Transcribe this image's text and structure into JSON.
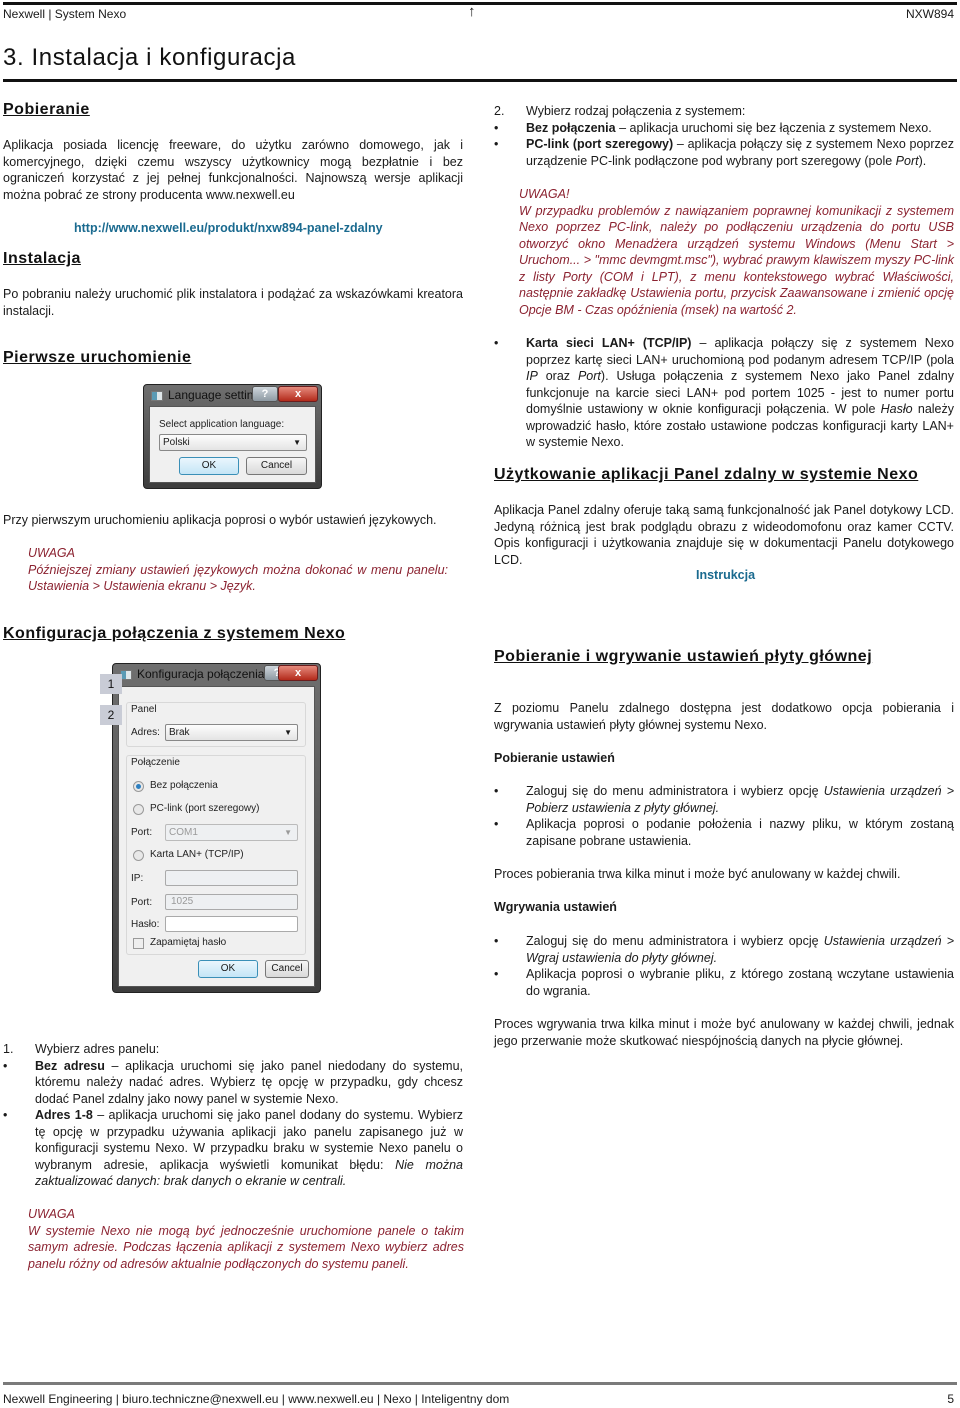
{
  "header": {
    "left": "Nexwell | System Nexo",
    "up_icon": "↑",
    "right": "NXW894"
  },
  "title": "3. Instalacja i konfiguracja",
  "left": {
    "pobieranie": {
      "heading": "Pobieranie",
      "text": "Aplikacja posiada licencję freeware, do użytku zarówno domowego, jak i komercyjnego, dzięki czemu wszyscy użytkownicy mogą bezpłatnie i bez ograniczeń korzystać z jej pełnej funkcjonalności. Najnowszą wersje aplikacji można pobrać ze strony producenta www.nexwell.eu",
      "link": "http://www.nexwell.eu/produkt/nxw894-panel-zdalny"
    },
    "instalacja": {
      "heading": "Instalacja",
      "text": "Po pobraniu należy uruchomić plik instalatora i podążać za wskazówkami kreatora instalacji."
    },
    "pierwsze": {
      "heading": "Pierwsze uruchomienie",
      "dialog": {
        "title": "Language settings",
        "help": "?",
        "close": "x",
        "label": "Select application language:",
        "selected": "Polski",
        "ok": "OK",
        "cancel": "Cancel"
      },
      "text": "Przy pierwszym uruchomieniu aplikacja poprosi o wybór ustawień językowych.",
      "note_title": "UWAGA",
      "note_text": "Późniejszej zmiany ustawień językowych można dokonać w menu panelu: Ustawienia > Ustawienia ekranu > Język."
    },
    "konfig": {
      "heading": "Konfiguracja połączenia z systemem Nexo",
      "callouts": [
        "1",
        "2"
      ],
      "dialog": {
        "title": "Konfiguracja połączenia",
        "help": "?",
        "close": "x",
        "panel_group": "Panel",
        "adres_label": "Adres:",
        "adres_value": "Brak",
        "polaczenie_group": "Połączenie",
        "opt_bez": "Bez połączenia",
        "opt_pclink": "PC-link (port szeregowy)",
        "port_label": "Port:",
        "port_value": "COM1",
        "opt_lan": "Karta LAN+ (TCP/IP)",
        "ip_label": "IP:",
        "ip_value": "",
        "port2_label": "Port:",
        "port2_value": "1025",
        "haslo_label": "Hasło:",
        "haslo_value": "",
        "remember": "Zapamiętaj hasło",
        "ok": "OK",
        "cancel": "Cancel"
      },
      "step1": {
        "num": "1.",
        "lead": "Wybierz adres panelu:",
        "items": [
          {
            "bold": "Bez adresu",
            "text": " – aplikacja uruchomi się jako panel niedodany do systemu, któremu należy nadać adres. Wybierz tę opcję w przypadku, gdy chcesz dodać Panel zdalny jako nowy panel w systemie Nexo.",
            "italic": ""
          },
          {
            "bold": "Adres 1-8",
            "text": " – aplikacja uruchomi się jako panel dodany do systemu. Wybierz tę opcję w przypadku używania aplikacji jako panelu zapisanego już w konfiguracji systemu Nexo. W przypadku braku w systemie Nexo panelu o wybranym adresie, aplikacja wyświetli komunikat błędu: ",
            "italic": "Nie można zaktualizować danych: brak danych o ekranie w centrali."
          }
        ]
      },
      "note_title": "UWAGA",
      "note_text": "W systemie Nexo nie mogą być jednocześnie uruchomione panele o takim samym adresie. Podczas łączenia aplikacji z systemem Nexo wybierz adres panelu różny od adresów aktualnie podłączonych do systemu paneli."
    }
  },
  "right": {
    "step2": {
      "num": "2.",
      "lead": "Wybierz rodzaj połączenia z systemem:",
      "items": [
        {
          "bold": "Bez połączenia",
          "text": " – aplikacja uruchomi się bez łączenia z systemem Nexo."
        },
        {
          "bold": "PC-link (port szeregowy)",
          "text": " – aplikacja połączy się z systemem Nexo poprzez urządzenie PC-link podłączone pod wybrany port szeregowy (pole ",
          "italic": "Port",
          "tail": ")."
        }
      ],
      "note_title": "UWAGA!",
      "note_text": "W przypadku problemów z nawiązaniem poprawnej komunikacji z systemem Nexo poprzez PC-link, należy po podłączeniu urządzenia do portu USB otworzyć okno Menadżera urządzeń systemu Windows (Menu Start > Uruchom... > \"mmc devmgmt.msc\"), wybrać prawym klawiszem myszy PC-link z listy Porty (COM i LPT), z menu kontekstowego wybrać Właściwości, następnie zakładkę Ustawienia portu, przycisk Zaawansowane i zmienić opcję Opcje BM - Czas opóźnienia (msek) na wartość 2.",
      "lan": {
        "bold": "Karta sieci LAN+ (TCP/IP)",
        "t1": " – aplikacja połączy się z systemem Nexo poprzez kartę sieci LAN+ uruchomioną pod podanym adresem TCP/IP (pola ",
        "i1": "IP",
        "t2": " oraz ",
        "i2": "Port",
        "t3": "). Usługa połączenia z systemem Nexo jako Panel zdalny funkcjonuje na karcie sieci LAN+ pod portem 1025 - jest to numer portu domyślnie ustawiony w  oknie konfiguracji połączenia. W pole ",
        "i3": "Hasło",
        "t4": " należy wprowadzić hasło, które zostało ustawione podczas konfiguracji karty LAN+ w systemie Nexo."
      }
    },
    "uzytkowanie": {
      "heading": "Użytkowanie aplikacji Panel zdalny w systemie Nexo",
      "text": "Aplikacja Panel zdalny oferuje taką samą funkcjonalność jak Panel dotykowy LCD. Jedyną różnicą jest brak podglądu obrazu z wideodomofonu oraz kamer CCTV. Opis konfiguracji i użytkowania znajduje się w dokumentacji Panelu dotykowego LCD.",
      "link": "Instrukcja"
    },
    "plyta": {
      "heading": "Pobieranie i wgrywanie ustawień płyty głównej",
      "intro": "Z poziomu Panelu zdalnego dostępna jest dodatkowo opcja pobierania i wgrywania ustawień płyty głównej systemu Nexo.",
      "pob_heading": "Pobieranie ustawień",
      "pob_items": [
        {
          "text": "Zaloguj się do menu administratora i wybierz opcję ",
          "italic": "Ustawienia urządzeń > Pobierz ustawienia z płyty głównej."
        },
        {
          "text": "Aplikacja poprosi o podanie położenia i nazwy pliku, w którym zostaną zapisane pobrane ustawienia.",
          "italic": ""
        }
      ],
      "pob_footer": "Proces pobierania trwa kilka minut i może być anulowany w każdej chwili.",
      "wgr_heading": "Wgrywania ustawień",
      "wgr_items": [
        {
          "text": "Zaloguj się do menu administratora i wybierz opcję ",
          "italic": "Ustawienia urządzeń > Wgraj ustawienia do płyty głównej."
        },
        {
          "text": "Aplikacja poprosi o wybranie pliku, z którego zostaną wczytane ustawienia do wgrania.",
          "italic": ""
        }
      ],
      "wgr_footer": "Proces wgrywania trwa kilka minut i może być anulowany w każdej chwili, jednak jego przerwanie może skutkować niespójnością danych na płycie głównej."
    }
  },
  "bullet": "•",
  "footer": {
    "left": "Nexwell Engineering | biuro.techniczne@nexwell.eu | www.nexwell.eu | Nexo | Inteligentny dom",
    "page": "5"
  }
}
